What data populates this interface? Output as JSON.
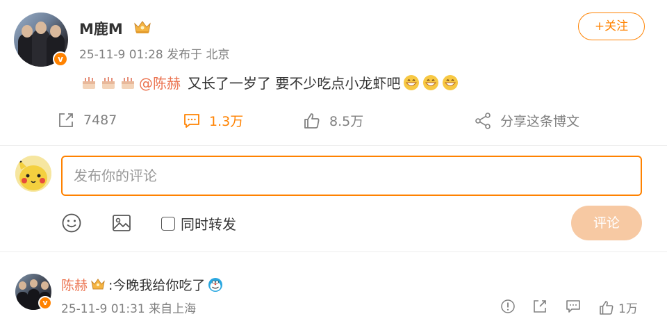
{
  "post": {
    "author": "M鹿M",
    "meta": "25-11-9 01:28 发布于 北京",
    "follow_label": "+关注",
    "verified_badge": "v",
    "content": {
      "mention": "@陈赫",
      "text": "又长了一岁了 要不少吃点小龙虾吧"
    },
    "actions": {
      "repost_count": "7487",
      "comment_count": "1.3万",
      "like_count": "8.5万",
      "share_label": "分享这条博文"
    }
  },
  "composer": {
    "placeholder": "发布你的评论",
    "repost_option": "同时转发",
    "submit_label": "评论"
  },
  "comments": [
    {
      "user": "陈赫",
      "text": ":今晚我给你吃了",
      "meta": "25-11-9 01:31 来自上海",
      "like_count": "1万",
      "verified_badge": "v"
    }
  ],
  "colors": {
    "accent": "#ff8200",
    "mention": "#eb7350",
    "submit_disabled": "#f7c9a3",
    "secondary_text": "#808080"
  }
}
